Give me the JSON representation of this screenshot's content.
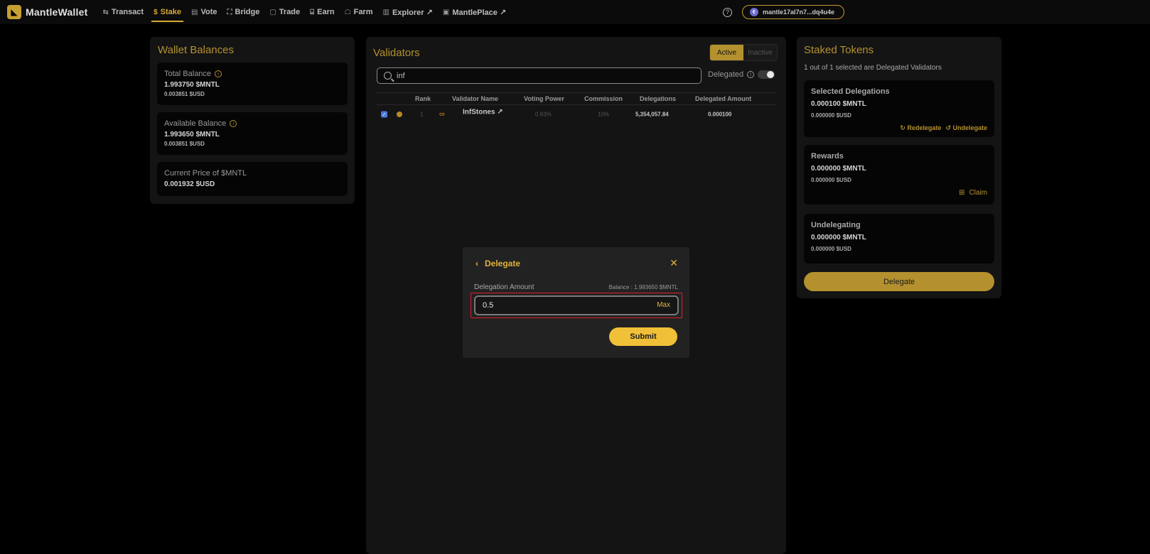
{
  "nav": {
    "brand": "MantleWallet",
    "items": [
      {
        "label": "Transact",
        "icon": "⇆"
      },
      {
        "label": "Stake",
        "icon": "$"
      },
      {
        "label": "Vote",
        "icon": "▤"
      },
      {
        "label": "Bridge",
        "icon": "⛶"
      },
      {
        "label": "Trade",
        "icon": "▢"
      },
      {
        "label": "Earn",
        "icon": "⌸"
      },
      {
        "label": "Farm",
        "icon": "☖"
      },
      {
        "label": "Explorer ↗",
        "icon": "▥"
      },
      {
        "label": "MantlePlace ↗",
        "icon": "▣"
      }
    ],
    "active": "Stake",
    "help": "?",
    "wallet_avatar": "€",
    "wallet_address": "mantle17al7n7...dq4u4e"
  },
  "wallet": {
    "title": "Wallet Balances",
    "total": {
      "label": "Total Balance",
      "value": "1.993750 $MNTL",
      "usd": "0.003851 $USD"
    },
    "available": {
      "label": "Available Balance",
      "value": "1.993650 $MNTL",
      "usd": "0.003851 $USD"
    },
    "price": {
      "label": "Current Price of $MNTL",
      "value": "0.001932 $USD"
    }
  },
  "validators": {
    "title": "Validators",
    "tab_active": "Active",
    "tab_inactive": "Inactive",
    "search_value": "inf",
    "delegated_label": "Delegated",
    "columns": [
      "Rank",
      "Validator Name",
      "Voting Power",
      "Commission",
      "Delegations",
      "Delegated Amount"
    ],
    "rows": [
      {
        "checked": "✓",
        "rank": "1",
        "name": "InfStones ↗",
        "voting_power": "0.83%",
        "commission": "10%",
        "delegations": "5,354,057.84",
        "delegated_amount": "0.000100"
      }
    ]
  },
  "staked": {
    "title": "Staked Tokens",
    "subtitle": "1 out of 1 selected are Delegated Validators",
    "selected": {
      "label": "Selected Delegations",
      "value": "0.000100 $MNTL",
      "usd": "0.000000 $USD",
      "redelegate": "Redelegate",
      "undelegate": "Undelegate"
    },
    "rewards": {
      "label": "Rewards",
      "value": "0.000000 $MNTL",
      "usd": "0.000000 $USD",
      "claim": "Claim"
    },
    "undelegating": {
      "label": "Undelegating",
      "value": "0.000000 $MNTL",
      "usd": "0.000000 $USD"
    },
    "delegate_button": "Delegate"
  },
  "modal": {
    "title": "Delegate",
    "amount_label": "Delegation Amount",
    "balance": "Balance : 1.993650 $MNTL",
    "amount_value": "0.5",
    "max_label": "Max",
    "submit_label": "Submit"
  },
  "colors": {
    "accent": "#d9a935",
    "highlight": "#e0202a"
  }
}
